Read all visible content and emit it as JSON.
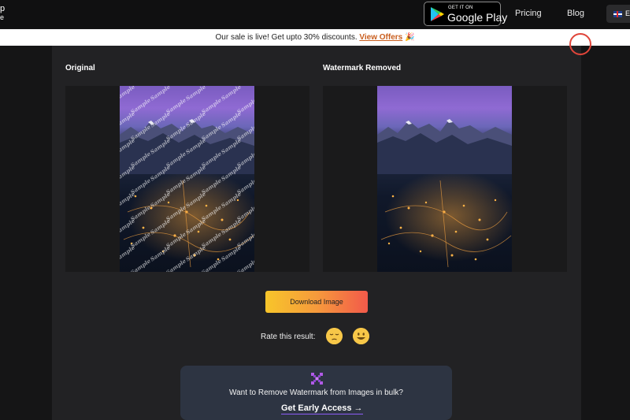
{
  "header": {
    "logo_fragment_1": "p",
    "logo_fragment_2": "e",
    "google_play": {
      "small": "GET IT ON",
      "big": "Google Play"
    },
    "nav": {
      "pricing": "Pricing",
      "blog": "Blog"
    },
    "language": "E"
  },
  "banner": {
    "text": "Our sale is live! Get upto 30% discounts.",
    "link": "View Offers",
    "emoji": "🎉"
  },
  "comparison": {
    "original_title": "Original",
    "removed_title": "Watermark Removed",
    "watermark_text": "Sample"
  },
  "actions": {
    "download_label": "Download Image",
    "rate_label": "Rate this result:"
  },
  "bulk": {
    "text": "Want to Remove Watermark from Images in bulk?",
    "cta": "Get Early Access →"
  },
  "colors": {
    "accent_orange": "#f69a3c",
    "accent_red": "#f25a4a",
    "accent_purple": "#8b5cf6",
    "close_red": "#e0453a"
  }
}
